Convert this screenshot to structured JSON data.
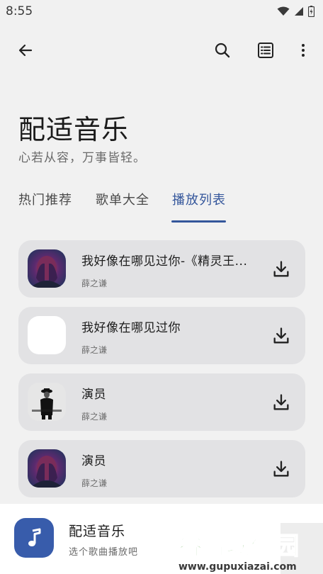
{
  "status_bar": {
    "time": "8:55",
    "icons": [
      "wifi-icon",
      "signal-icon",
      "battery-charging-icon"
    ]
  },
  "toolbar": {
    "back_icon": "arrow-left-icon",
    "search_icon": "search-icon",
    "list_icon": "list-icon",
    "more_icon": "more-vertical-icon"
  },
  "header": {
    "title": "配适音乐",
    "subtitle": "心若从容，万事皆轻。"
  },
  "tabs": [
    {
      "label": "热门推荐",
      "active": false
    },
    {
      "label": "歌单大全",
      "active": false
    },
    {
      "label": "播放列表",
      "active": true
    }
  ],
  "songs": [
    {
      "title": "我好像在哪见过你-《精灵王...",
      "artist": "薛之谦",
      "cover": "face-hands-art",
      "action_icon": "download-icon"
    },
    {
      "title": "我好像在哪见过你",
      "artist": "薛之谦",
      "cover": "blank",
      "action_icon": "download-icon"
    },
    {
      "title": "演员",
      "artist": "薛之谦",
      "cover": "person-silhouette",
      "action_icon": "download-icon"
    },
    {
      "title": "演员",
      "artist": "薛之谦",
      "cover": "face-hands-art",
      "action_icon": "download-icon"
    }
  ],
  "player": {
    "title": "配适音乐",
    "subtitle": "选个歌曲播放吧",
    "icon": "music-note-icon",
    "accent": "#385cab"
  },
  "watermark": {
    "text_cn": "谷普软件园",
    "text_url": "www.gupuxiazai.com"
  },
  "colors": {
    "accent": "#34569b",
    "card": "#e2e2e4",
    "background": "#f1f1f1"
  }
}
